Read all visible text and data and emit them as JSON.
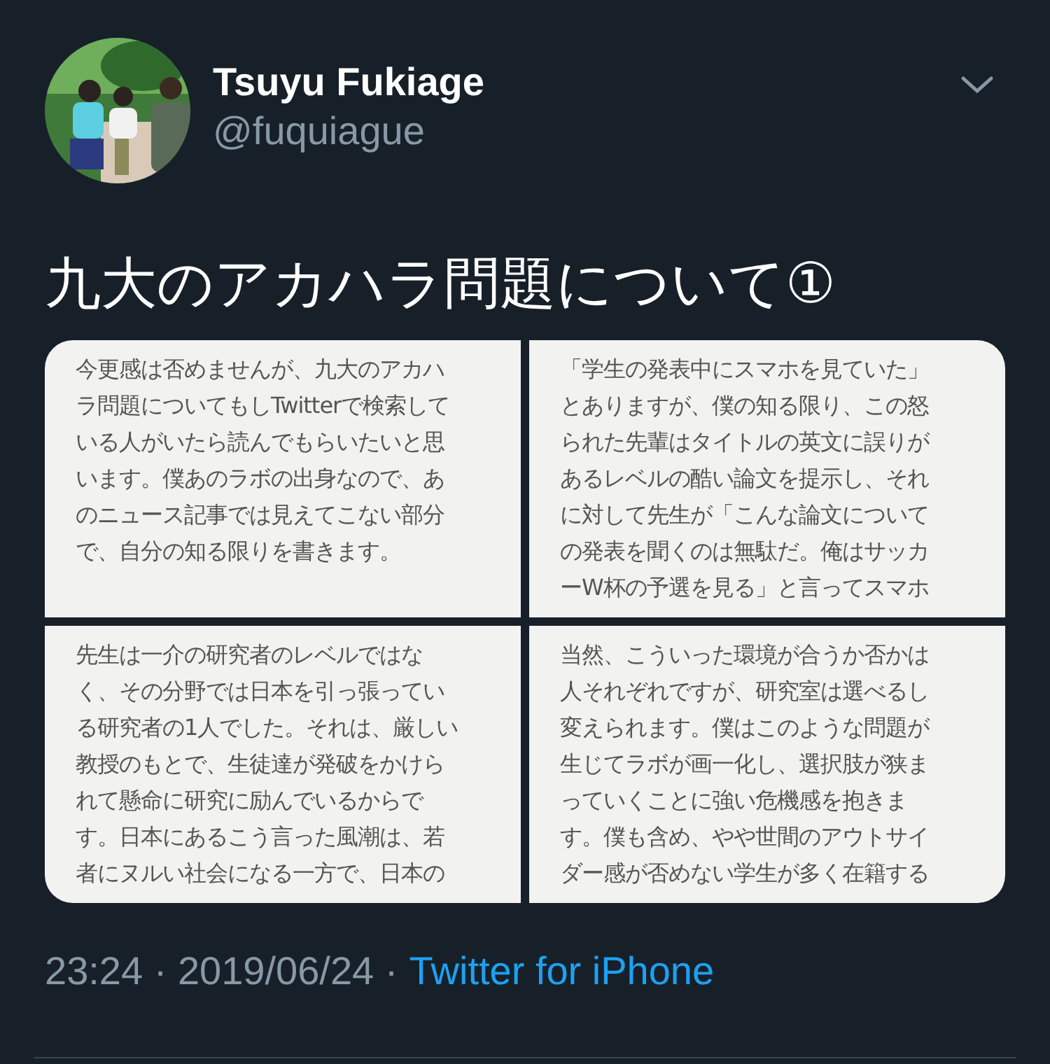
{
  "author": {
    "name": "Tsuyu Fukiage",
    "handle": "@fuquiague"
  },
  "tweet_text": "九大のアカハラ問題について①",
  "images": [
    {
      "lines": [
        "今更感は否めませんが、九大のアカハ",
        "ラ問題についてもしTwitterで検索して",
        "いる人がいたら読んでもらいたいと思",
        "います。僕あのラボの出身なので、あ",
        "のニュース記事では見えてこない部分",
        "で、自分の知る限りを書きます。"
      ]
    },
    {
      "lines": [
        "「学生の発表中にスマホを見ていた」",
        "とありますが、僕の知る限り、この怒",
        "られた先輩はタイトルの英文に誤りが",
        "あるレベルの酷い論文を提示し、それ",
        "に対して先生が「こんな論文について",
        "の発表を聞くのは無駄だ。俺はサッカ",
        "ーW杯の予選を見る」と言ってスマホ"
      ]
    },
    {
      "lines": [
        "先生は一介の研究者のレベルではな",
        "く、その分野では日本を引っ張ってい",
        "る研究者の1人でした。それは、厳しい",
        "教授のもとで、生徒達が発破をかけら",
        "れて懸命に研究に励んでいるからで",
        "す。日本にあるこう言った風潮は、若",
        "者にヌルい社会になる一方で、日本の"
      ]
    },
    {
      "lines": [
        "当然、こういった環境が合うか否かは",
        "人それぞれですが、研究室は選べるし",
        "変えられます。僕はこのような問題が",
        "生じてラボが画一化し、選択肢が狭ま",
        "っていくことに強い危機感を抱きま",
        "す。僕も含め、やや世間のアウトサイ",
        "ダー感が否めない学生が多く在籍する"
      ]
    }
  ],
  "timestamp": "23:24 · 2019/06/24 ·",
  "source": "Twitter for iPhone"
}
